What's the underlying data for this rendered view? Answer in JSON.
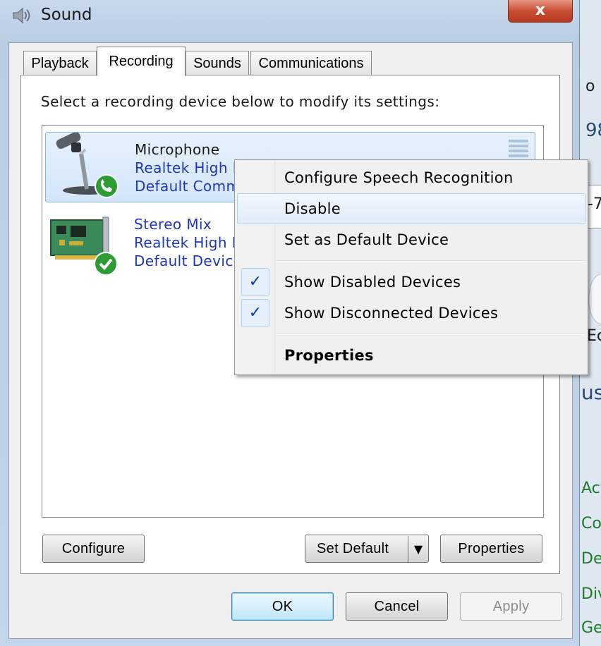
{
  "window": {
    "title": "Sound",
    "close_glyph": "x"
  },
  "tabs": [
    {
      "label": "Playback",
      "selected": false
    },
    {
      "label": "Recording",
      "selected": true
    },
    {
      "label": "Sounds",
      "selected": false
    },
    {
      "label": "Communications",
      "selected": false
    }
  ],
  "instruction": "Select a recording device below to modify its settings:",
  "devices": [
    {
      "name": "Microphone",
      "line2": "Realtek High I",
      "line3": "Default Comm",
      "icon": "microphone-icon",
      "status_icon": "phone-check-icon",
      "selected": true
    },
    {
      "name": "Stereo Mix",
      "line2": "Realtek High I",
      "line3": "Default Device",
      "icon": "sound-card-icon",
      "status_icon": "green-check-icon",
      "selected": false
    }
  ],
  "buttons": {
    "configure": "Configure",
    "set_default": "Set Default",
    "set_default_arrow": "▼",
    "properties": "Properties",
    "ok": "OK",
    "cancel": "Cancel",
    "apply": "Apply"
  },
  "context_menu": {
    "items": [
      {
        "label": "Configure Speech Recognition",
        "checked": false,
        "bold": false
      },
      {
        "label": "Disable",
        "checked": false,
        "bold": false,
        "highlighted": true
      },
      {
        "label": "Set as Default Device",
        "checked": false,
        "bold": false
      },
      {
        "label": "Show Disabled Devices",
        "checked": true,
        "bold": false
      },
      {
        "label": "Show Disconnected Devices",
        "checked": true,
        "bold": false
      },
      {
        "label": "Properties",
        "checked": false,
        "bold": true
      }
    ],
    "check_glyph": "✓"
  },
  "background_window": {
    "fragments": [
      "o D",
      "98",
      "-7",
      "Ec",
      "us",
      "Act",
      "Col",
      "Des",
      "Div",
      "Get"
    ]
  },
  "colors": {
    "title_bar": "#c9d9ec",
    "close_button": "#c84e33",
    "link_blue": "#1f36b8",
    "selection_fill": "#d3e6f9",
    "selection_border": "#7eb4ea"
  }
}
